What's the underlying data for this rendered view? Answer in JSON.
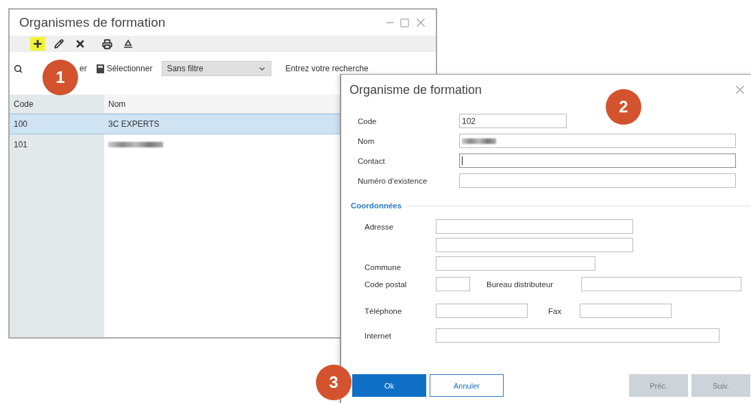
{
  "window": {
    "title": "Organismes de formation"
  },
  "toolbar": [
    {
      "kind": "add",
      "highlighted": true
    },
    {
      "kind": "edit",
      "highlighted": false
    },
    {
      "kind": "delete",
      "highlighted": false
    },
    {
      "kind": "print",
      "highlighted": false
    },
    {
      "kind": "export",
      "highlighted": false
    }
  ],
  "search_bar": {
    "search_label": "er",
    "select_label": "Sélectionner",
    "filter": "Sans filtre",
    "search_placeholder": "Entrez votre recherche"
  },
  "table": {
    "columns": [
      "Code",
      "Nom"
    ],
    "rows": [
      {
        "code": "100",
        "name": "3C EXPERTS",
        "name_blurred": false,
        "selected": true
      },
      {
        "code": "101",
        "name_blurred": true,
        "selected": false
      }
    ]
  },
  "dialog": {
    "title": "Organisme de formation",
    "fields": [
      {
        "label": "Code",
        "value": "102",
        "kind": "short",
        "blurred": false,
        "focused": false
      },
      {
        "label": "Nom",
        "kind": "long",
        "blurred": true,
        "focused": false
      },
      {
        "label": "Contact",
        "kind": "long",
        "blurred": false,
        "focused": true
      },
      {
        "label": "Numéro d'existence",
        "kind": "long",
        "blurred": false,
        "focused": false
      }
    ],
    "coordinates": {
      "title": "Coordonnées",
      "address_label": "Adresse",
      "commune_label": "Commune",
      "postal_code_label": "Code postal",
      "bureau_label": "Bureau distributeur",
      "phone_label": "Téléphone",
      "fax_label": "Fax",
      "internet_label": "Internet"
    },
    "buttons": [
      {
        "label": "Ok",
        "kind": "primary"
      },
      {
        "label": "Annuler",
        "kind": "secondary"
      },
      {
        "label": "Préc.",
        "kind": "disabled"
      },
      {
        "label": "Suiv.",
        "kind": "disabled"
      }
    ]
  },
  "badges": [
    "1",
    "2",
    "3"
  ]
}
